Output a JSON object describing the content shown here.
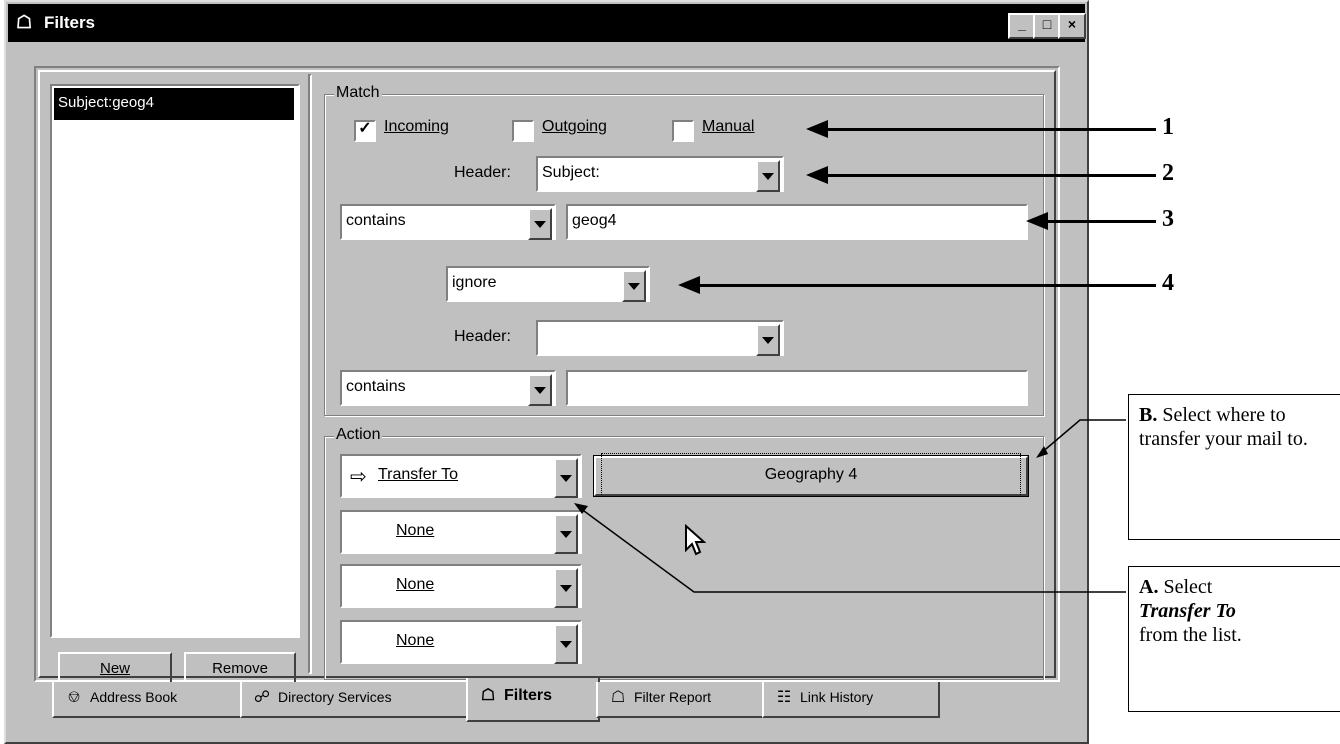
{
  "window": {
    "title": "Filters",
    "title_icon": "filters-icon",
    "controls": {
      "minimize": "_",
      "maximize": "□",
      "close": "×"
    }
  },
  "filter_list": {
    "items": [
      "Subject:geog4"
    ],
    "new_button": "New",
    "remove_button": "Remove"
  },
  "match": {
    "legend": "Match",
    "incoming": {
      "label": "Incoming",
      "checked": true
    },
    "outgoing": {
      "label": "Outgoing",
      "checked": false
    },
    "manual": {
      "label": "Manual",
      "checked": false
    },
    "header1_label": "Header:",
    "header1_value": "Subject:",
    "condition1": "contains",
    "value1": "geog4",
    "conjunction": "ignore",
    "header2_label": "Header:",
    "header2_value": "",
    "condition2": "contains",
    "value2": ""
  },
  "action": {
    "legend": "Action",
    "action1": "Transfer To",
    "action1_icon": "right-arrow-icon",
    "destination": "Geography 4",
    "action2": "None",
    "action3": "None",
    "action4": "None"
  },
  "tabs": [
    {
      "label": "Address Book",
      "icon": "address-book-icon",
      "active": false
    },
    {
      "label": "Directory Services",
      "icon": "directory-services-icon",
      "active": false
    },
    {
      "label": "Filters",
      "icon": "filters-icon",
      "active": true
    },
    {
      "label": "Filter Report",
      "icon": "filter-report-icon",
      "active": false
    },
    {
      "label": "Link History",
      "icon": "link-history-icon",
      "active": false
    }
  ],
  "annotations": {
    "labels": [
      "1",
      "2",
      "3",
      "4"
    ],
    "callout_b": {
      "bold": "B.",
      "text": "Select where to transfer your mail to."
    },
    "callout_a": {
      "bold": "A.",
      "text1": "Select",
      "italic": "Transfer To",
      "text2": "from the list."
    }
  }
}
